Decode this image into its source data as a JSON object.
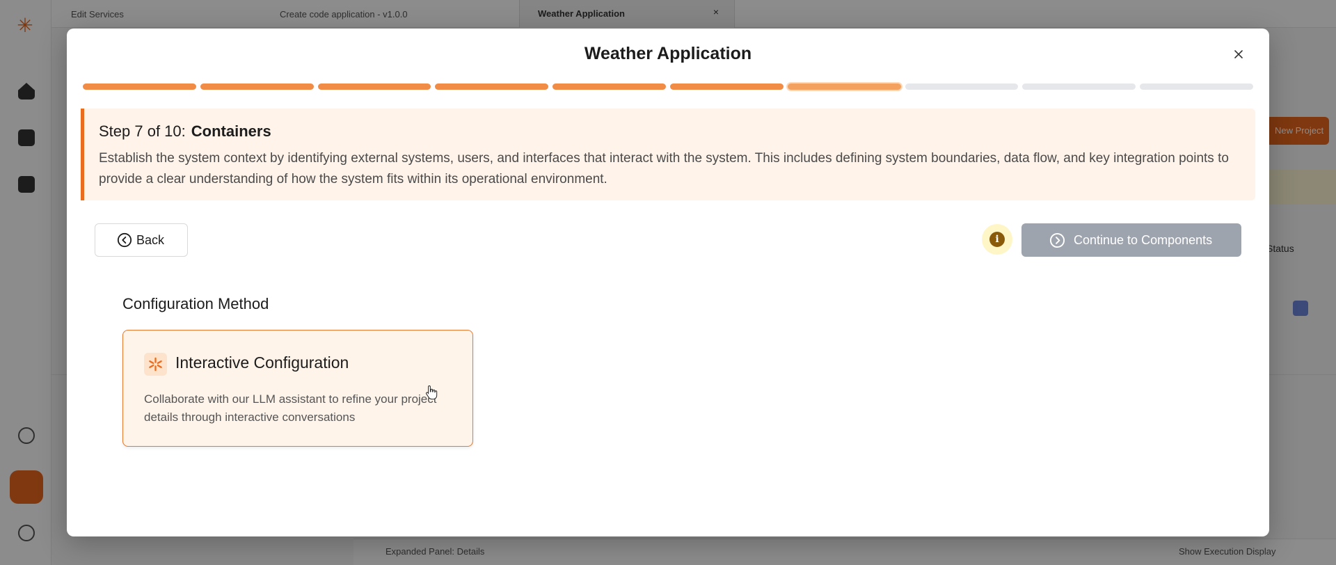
{
  "background": {
    "top_left_text": "Edit Services",
    "top_dropdown": "Create code application - v1.0.0",
    "tab_label": "Weather Application",
    "tab_close": "×",
    "action_button": "New Project",
    "side_text": "Status",
    "footer_left": "Expanded Panel: Details",
    "footer_right": "Show Execution Display"
  },
  "modal": {
    "title": "Weather Application",
    "close_label": "Close"
  },
  "progress": {
    "total_steps": 10,
    "current_step": 7
  },
  "step": {
    "prefix": "Step 7 of 10:",
    "name": "Containers",
    "description": "Establish the system context by identifying external systems, users, and interfaces that interact with the system. This includes defining system boundaries, data flow, and key integration points to provide a clear understanding of how the system fits within its operational environment."
  },
  "actions": {
    "back_label": "Back",
    "continue_label": "Continue to Components",
    "info_symbol": "i"
  },
  "configuration": {
    "section_label": "Configuration Method",
    "card_title": "Interactive Configuration",
    "card_description": "Collaborate with our LLM assistant to refine your project details through interactive conversations"
  },
  "colors": {
    "accent": "#ea6c1e",
    "progress_done": "#f08c45",
    "progress_todo": "#e6e7ea",
    "step_bg": "#fff3ea",
    "continue_disabled": "#9ea4ad",
    "info_bg": "#fff6c8",
    "info_fg": "#8a5a0b"
  },
  "icons": {
    "close": "close-icon",
    "back": "chevron-left-circle-icon",
    "continue": "chevron-right-circle-icon",
    "info": "info-icon",
    "card": "sparkle-asterisk-icon"
  }
}
